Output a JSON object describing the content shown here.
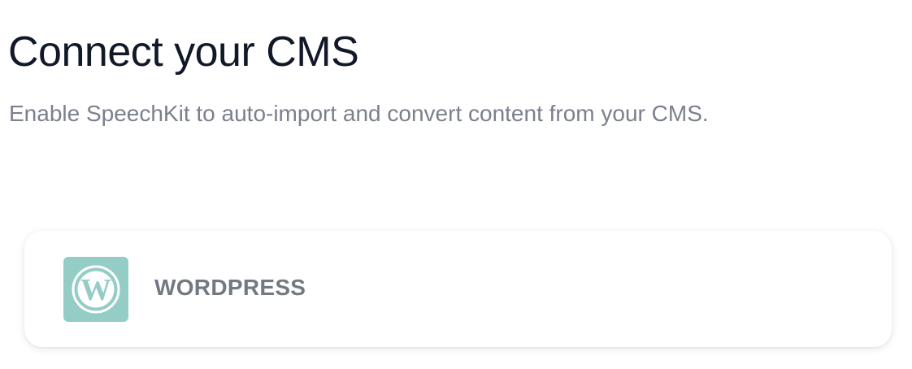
{
  "header": {
    "title": "Connect your CMS",
    "subtitle": "Enable SpeechKit to auto-import and convert content from your CMS."
  },
  "cms_options": [
    {
      "label": "WORDPRESS",
      "icon": "wordpress-icon",
      "icon_background": "#94cdc5",
      "icon_foreground": "#ffffff"
    }
  ],
  "colors": {
    "title": "#111827",
    "subtitle": "#7b808c",
    "card_label": "#747884",
    "background": "#ffffff"
  }
}
